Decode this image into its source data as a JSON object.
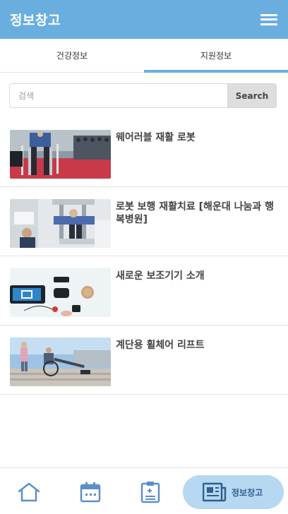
{
  "header": {
    "title": "정보창고"
  },
  "tabs": [
    {
      "label": "건강정보",
      "active": false
    },
    {
      "label": "지원정보",
      "active": true
    }
  ],
  "search": {
    "placeholder": "검색",
    "value": "",
    "button_label": "Search"
  },
  "articles": [
    {
      "title": "웨어러블 재활 로봇"
    },
    {
      "title": "로봇 보행 재활치료 [해운대 나눔과 행복병원]"
    },
    {
      "title": "새로운 보조기기 소개"
    },
    {
      "title": "계단용 휠체어 리프트"
    }
  ],
  "bottom_nav": {
    "active_label": "정보창고",
    "icons": [
      "home-icon",
      "calendar-icon",
      "clipboard-icon",
      "newspaper-icon"
    ]
  },
  "colors": {
    "primary": "#6aaee0",
    "active_nav_bg": "#b6d8f1",
    "icon_blue": "#5b8fc9"
  }
}
